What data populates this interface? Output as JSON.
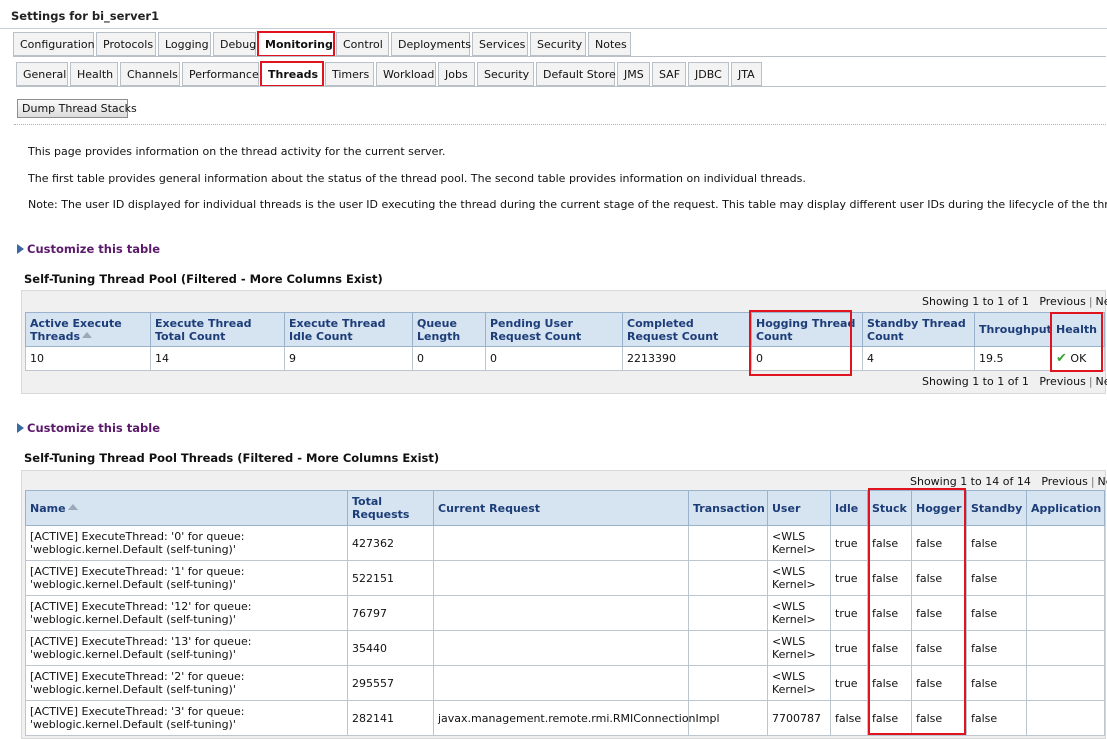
{
  "window": {
    "title": "Settings for bi_server1"
  },
  "main_tabs": [
    {
      "label": "Configuration"
    },
    {
      "label": "Protocols"
    },
    {
      "label": "Logging"
    },
    {
      "label": "Debug"
    },
    {
      "label": "Monitoring"
    },
    {
      "label": "Control"
    },
    {
      "label": "Deployments"
    },
    {
      "label": "Services"
    },
    {
      "label": "Security"
    },
    {
      "label": "Notes"
    }
  ],
  "sub_tabs": [
    {
      "label": "General"
    },
    {
      "label": "Health"
    },
    {
      "label": "Channels"
    },
    {
      "label": "Performance"
    },
    {
      "label": "Threads"
    },
    {
      "label": "Timers"
    },
    {
      "label": "Workload"
    },
    {
      "label": "Jobs"
    },
    {
      "label": "Security"
    },
    {
      "label": "Default Store"
    },
    {
      "label": "JMS"
    },
    {
      "label": "SAF"
    },
    {
      "label": "JDBC"
    },
    {
      "label": "JTA"
    }
  ],
  "actions": {
    "dump_label": "Dump Thread Stacks"
  },
  "intro": {
    "p1": "This page provides information on the thread activity for the current server.",
    "p2": "The first table provides general information about the status of the thread pool. The second table provides information on individual threads.",
    "p3": "Note: The user ID displayed for individual threads is the user ID executing the thread during the current stage of the request. This table may display different user IDs during the lifecycle of the thread."
  },
  "customize_label": "Customize this table",
  "pool": {
    "title": "Self-Tuning Thread Pool (Filtered - More Columns Exist)",
    "pager_status": "Showing 1 to 1 of 1",
    "prev": "Previous",
    "next": "Next",
    "headers": {
      "active": "Active Execute Threads",
      "total": "Execute Thread Total Count",
      "idle": "Execute Thread Idle Count",
      "queue": "Queue Length",
      "pending": "Pending User Request Count",
      "completed": "Completed Request Count",
      "hogging": "Hogging Thread Count",
      "standby": "Standby Thread Count",
      "throughput": "Throughput",
      "health": "Health"
    },
    "row": {
      "active": "10",
      "total": "14",
      "idle": "9",
      "queue": "0",
      "pending": "0",
      "completed": "2213390",
      "hogging": "0",
      "standby": "4",
      "throughput": "19.5",
      "health": "OK"
    }
  },
  "threads": {
    "title": "Self-Tuning Thread Pool Threads (Filtered - More Columns Exist)",
    "pager_status": "Showing 1 to 14 of 14",
    "prev": "Previous",
    "next": "Next",
    "headers": {
      "name": "Name",
      "total": "Total Requests",
      "current": "Current Request",
      "transaction": "Transaction",
      "user": "User",
      "idle": "Idle",
      "stuck": "Stuck",
      "hogger": "Hogger",
      "standby": "Standby",
      "application": "Application"
    },
    "rows": [
      {
        "name": "[ACTIVE] ExecuteThread: '0' for queue: 'weblogic.kernel.Default (self-tuning)'",
        "total": "427362",
        "current": "",
        "transaction": "",
        "user": "<WLS Kernel>",
        "idle": "true",
        "stuck": "false",
        "hogger": "false",
        "standby": "false",
        "application": ""
      },
      {
        "name": "[ACTIVE] ExecuteThread: '1' for queue: 'weblogic.kernel.Default (self-tuning)'",
        "total": "522151",
        "current": "",
        "transaction": "",
        "user": "<WLS Kernel>",
        "idle": "true",
        "stuck": "false",
        "hogger": "false",
        "standby": "false",
        "application": ""
      },
      {
        "name": "[ACTIVE] ExecuteThread: '12' for queue: 'weblogic.kernel.Default (self-tuning)'",
        "total": "76797",
        "current": "",
        "transaction": "",
        "user": "<WLS Kernel>",
        "idle": "true",
        "stuck": "false",
        "hogger": "false",
        "standby": "false",
        "application": ""
      },
      {
        "name": "[ACTIVE] ExecuteThread: '13' for queue: 'weblogic.kernel.Default (self-tuning)'",
        "total": "35440",
        "current": "",
        "transaction": "",
        "user": "<WLS Kernel>",
        "idle": "true",
        "stuck": "false",
        "hogger": "false",
        "standby": "false",
        "application": ""
      },
      {
        "name": "[ACTIVE] ExecuteThread: '2' for queue: 'weblogic.kernel.Default (self-tuning)'",
        "total": "295557",
        "current": "",
        "transaction": "",
        "user": "<WLS Kernel>",
        "idle": "true",
        "stuck": "false",
        "hogger": "false",
        "standby": "false",
        "application": ""
      },
      {
        "name": "[ACTIVE] ExecuteThread: '3' for queue: 'weblogic.kernel.Default (self-tuning)'",
        "total": "282141",
        "current": "javax.management.remote.rmi.RMIConnectionImpl",
        "transaction": "",
        "user": "7700787",
        "idle": "false",
        "stuck": "false",
        "hogger": "false",
        "standby": "false",
        "application": ""
      }
    ]
  }
}
